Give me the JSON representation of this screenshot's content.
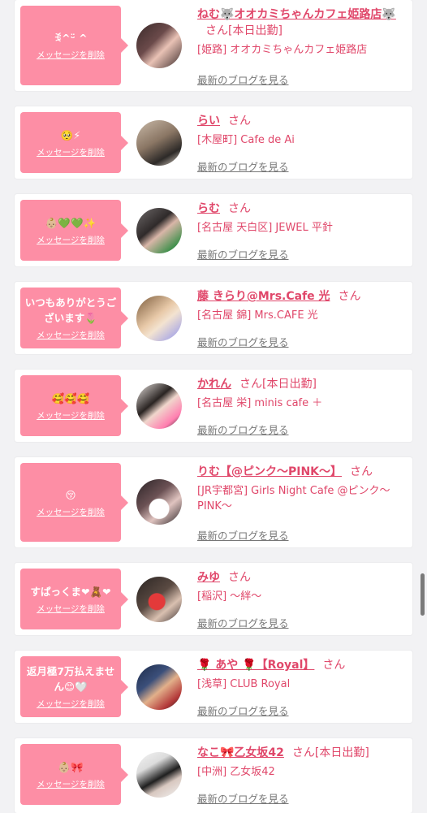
{
  "delete_label": "メッセージを削除",
  "blog_label": "最新のブログを見る",
  "san_label": "さん",
  "items": [
    {
      "message": "ꉂ^ᵕ̈ ^",
      "name": "ねむ🐺オオカミちゃんカフェ姫路店🐺",
      "status": "[本日出勤]",
      "shop": "[姫路] オオカミちゃんカフェ姫路店"
    },
    {
      "message": "🥺⚡",
      "name": "らい",
      "status": "",
      "shop": "[木屋町] Cafe de Ai"
    },
    {
      "message": "👶🏼💚💚✨",
      "name": "らむ",
      "status": "",
      "shop": "[名古屋 天白区] JEWEL 平針"
    },
    {
      "message": "いつもありがとうございます🌷",
      "name": "藤 きらり@Mrs.Cafe 光",
      "status": "",
      "shop": "[名古屋 錦] Mrs.CAFE 光"
    },
    {
      "message": "🥰🥰🥰",
      "name": "かれん",
      "status": "[本日出勤]",
      "shop": "[名古屋 栄] minis cafe ＋"
    },
    {
      "message": "😚",
      "name": "りむ【@ピンク〜PINK〜】",
      "status": "",
      "shop": "[JR宇都宮] Girls Night Cafe @ピンク〜PINK〜"
    },
    {
      "message": "すぱっくま❤🧸❤",
      "name": "みゆ",
      "status": "",
      "shop": "[稲沢] 〜絆〜"
    },
    {
      "message": "返月極7万払えません😊🤍",
      "name": "🌹 あや 🌹【Royal】",
      "status": "",
      "shop": "[浅草] CLUB Royal"
    },
    {
      "message": "👶🏼🎀",
      "name": "なこ🎀乙女坂42",
      "status": "[本日出勤]",
      "shop": "[中洲] 乙女坂42"
    }
  ],
  "colors": {
    "accent": "#e0476a",
    "bubble": "#fd8ea5",
    "background": "#f2f2f4"
  }
}
